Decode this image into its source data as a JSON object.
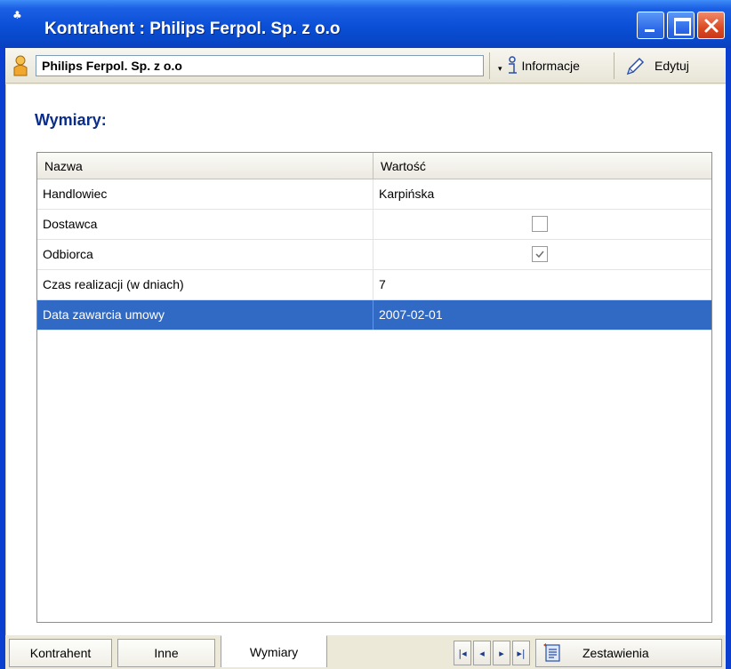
{
  "window": {
    "title": "Kontrahent : Philips Ferpol. Sp. z o.o"
  },
  "toolbar": {
    "contractor_name": "Philips Ferpol. Sp. z o.o",
    "info_label": "Informacje",
    "edit_label": "Edytuj"
  },
  "section": {
    "title": "Wymiary:"
  },
  "grid": {
    "headers": [
      "Nazwa",
      "Wartość"
    ],
    "rows": [
      {
        "name": "Handlowiec",
        "value": "Karpińska"
      },
      {
        "name": "Dostawca",
        "value": "",
        "checkbox": false
      },
      {
        "name": "Odbiorca",
        "value": "",
        "checkbox": true
      },
      {
        "name": "Czas realizacji (w dniach)",
        "value": "7"
      },
      {
        "name": "Data zawarcia umowy",
        "value": "2007-02-01",
        "selected": true
      }
    ]
  },
  "tabs": [
    {
      "label": "Kontrahent"
    },
    {
      "label": "Inne"
    },
    {
      "label": "Wymiary",
      "active": true
    }
  ],
  "bottom": {
    "report_label": "Zestawienia"
  },
  "colors": {
    "titlebar": "#0a4fd6",
    "selection": "#316ac5",
    "section_title": "#0b2d8a"
  }
}
